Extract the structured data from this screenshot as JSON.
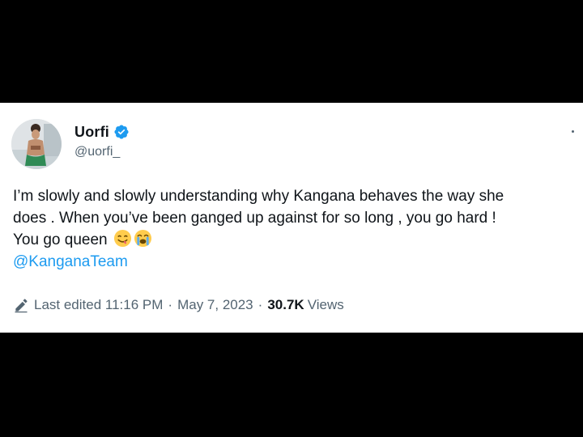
{
  "tweet": {
    "author": {
      "display_name": "Uorfi",
      "handle": "@uorfi_",
      "verified": true,
      "verified_color": "#1d9bf0",
      "avatar_icon": "profile-photo"
    },
    "more_icon": "more-options-icon",
    "text_lines": [
      "I’m slowly and slowly understanding why Kangana behaves the way she",
      "does . When you’ve been ganged up against for so long , you go hard !",
      "You go queen"
    ],
    "emojis": [
      "face-savoring-food-emoji",
      "loudly-crying-face-emoji"
    ],
    "mention": "@KanganaTeam",
    "footer": {
      "edit_icon": "pencil-icon",
      "last_edited": "Last edited 11:16 PM",
      "separator": "·",
      "date": "May 7, 2023",
      "views_count": "30.7K",
      "views_label": "Views"
    },
    "colors": {
      "text": "#0f1419",
      "secondary": "#536471",
      "link": "#1d9bf0",
      "background": "#ffffff",
      "letterbox": "#000000"
    }
  }
}
